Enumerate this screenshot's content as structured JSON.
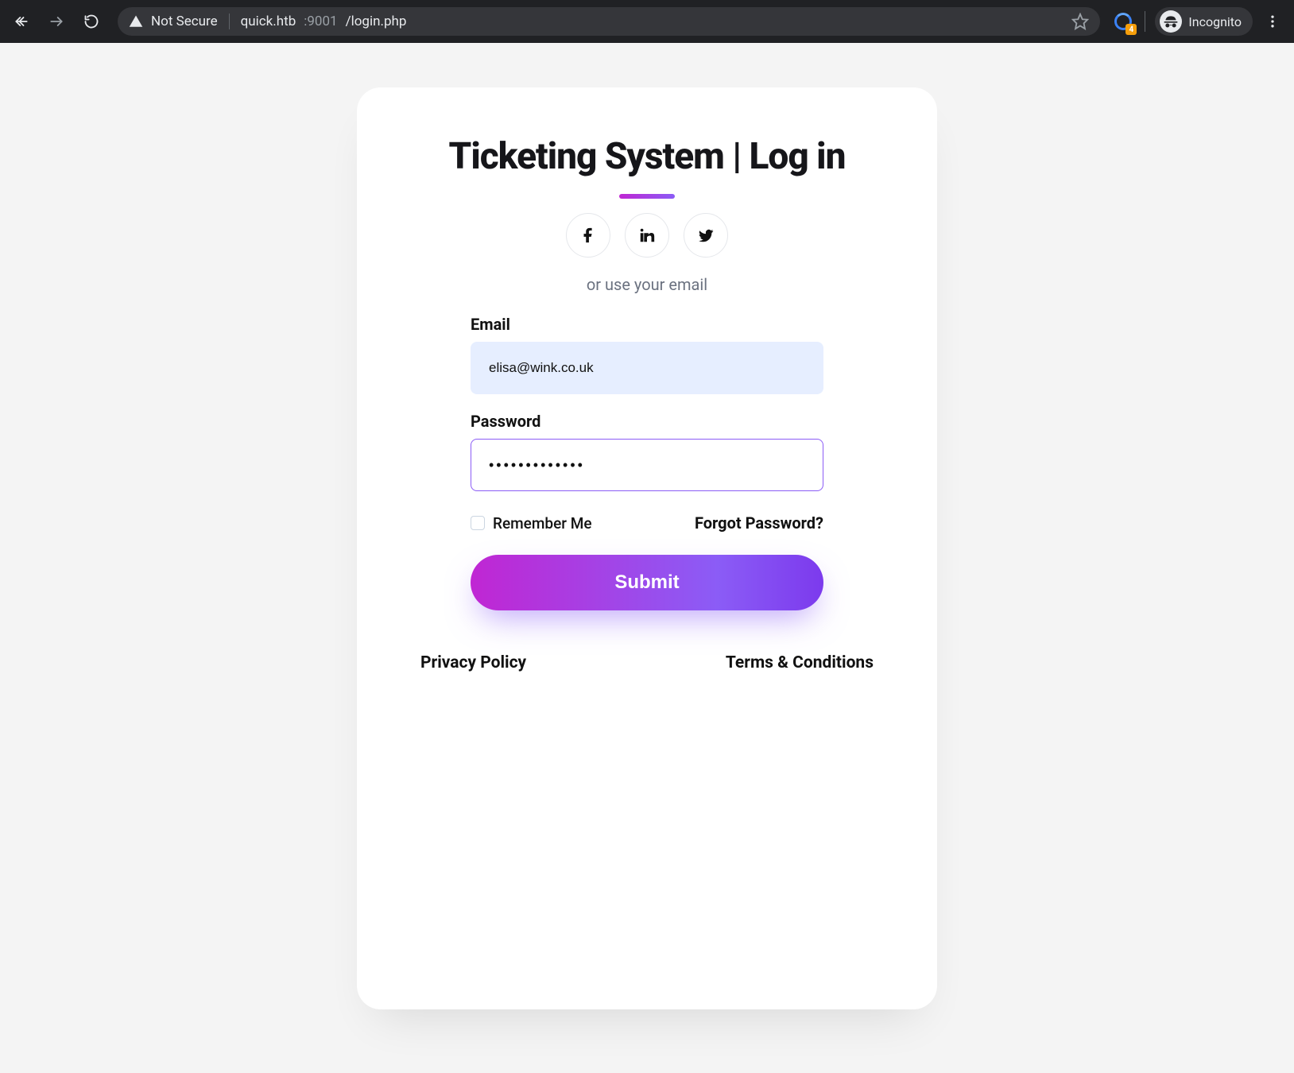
{
  "browser": {
    "security_label": "Not Secure",
    "url": {
      "host": "quick.htb",
      "port": ":9001",
      "path": "/login.php"
    },
    "extension_badge": "4",
    "incognito_label": "Incognito"
  },
  "login": {
    "title": "Ticketing System | Log in",
    "hint": "or use your email",
    "email_label": "Email",
    "email_value": "elisa@wink.co.uk",
    "password_label": "Password",
    "password_value": "•••••••••••••",
    "remember_label": "Remember Me",
    "forgot_label": "Forgot Password?",
    "submit_label": "Submit",
    "privacy_label": "Privacy Policy",
    "terms_label": "Terms & Conditions",
    "social": {
      "facebook": "facebook",
      "linkedin": "linkedin",
      "twitter": "twitter"
    }
  }
}
